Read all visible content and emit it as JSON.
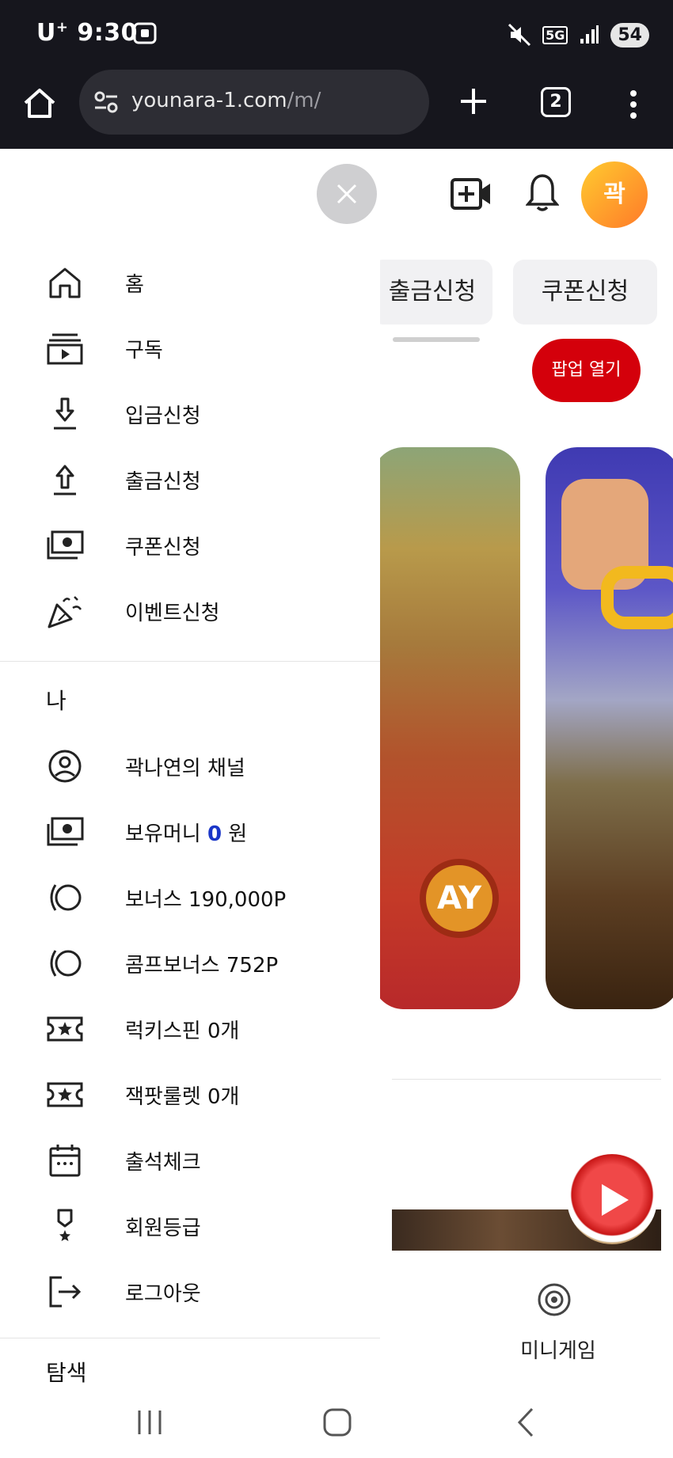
{
  "status_bar": {
    "carrier": "U",
    "carrier_sup": "+",
    "time": "9:30",
    "network": "5G",
    "battery": "54"
  },
  "browser": {
    "url_domain": "younara-1.com",
    "url_path": "/m/",
    "tab_count": "2"
  },
  "page": {
    "header": {
      "avatar_text": "곽"
    },
    "chips": [
      "출금신청",
      "쿠폰신청"
    ],
    "popup_button": "팝업 열기",
    "card1_badge": "AY",
    "minigame_label": "미니게임"
  },
  "drawer": {
    "main_items": [
      {
        "icon": "home-icon",
        "label": "홈"
      },
      {
        "icon": "subscriptions-icon",
        "label": "구독"
      },
      {
        "icon": "deposit-icon",
        "label": "입금신청"
      },
      {
        "icon": "withdraw-icon",
        "label": "출금신청"
      },
      {
        "icon": "coupon-icon",
        "label": "쿠폰신청"
      },
      {
        "icon": "party-popper-icon",
        "label": "이벤트신청"
      }
    ],
    "me_section_title": "나",
    "me_items": [
      {
        "icon": "account-circle-icon",
        "label": "곽나연의 채널"
      },
      {
        "icon": "money-icon",
        "label_prefix": "보유머니 ",
        "amount": "0",
        "label_suffix": " 원"
      },
      {
        "icon": "bonus-icon",
        "label": "보너스 190,000P"
      },
      {
        "icon": "comp-bonus-icon",
        "label": "콤프보너스 752P"
      },
      {
        "icon": "ticket-star-icon",
        "label": "럭키스핀 0개"
      },
      {
        "icon": "ticket-star-icon",
        "label": "잭팟룰렛 0개"
      },
      {
        "icon": "calendar-icon",
        "label": "출석체크"
      },
      {
        "icon": "medal-icon",
        "label": "회원등급"
      },
      {
        "icon": "logout-icon",
        "label": "로그아웃"
      }
    ],
    "explore_title": "탐색"
  },
  "colors": {
    "status_bg": "#16161d",
    "accent_red": "#d4000b",
    "avatar_gradient_from": "#ffcb2f",
    "avatar_gradient_to": "#ff7a29",
    "money_blue": "#1a36c8"
  }
}
